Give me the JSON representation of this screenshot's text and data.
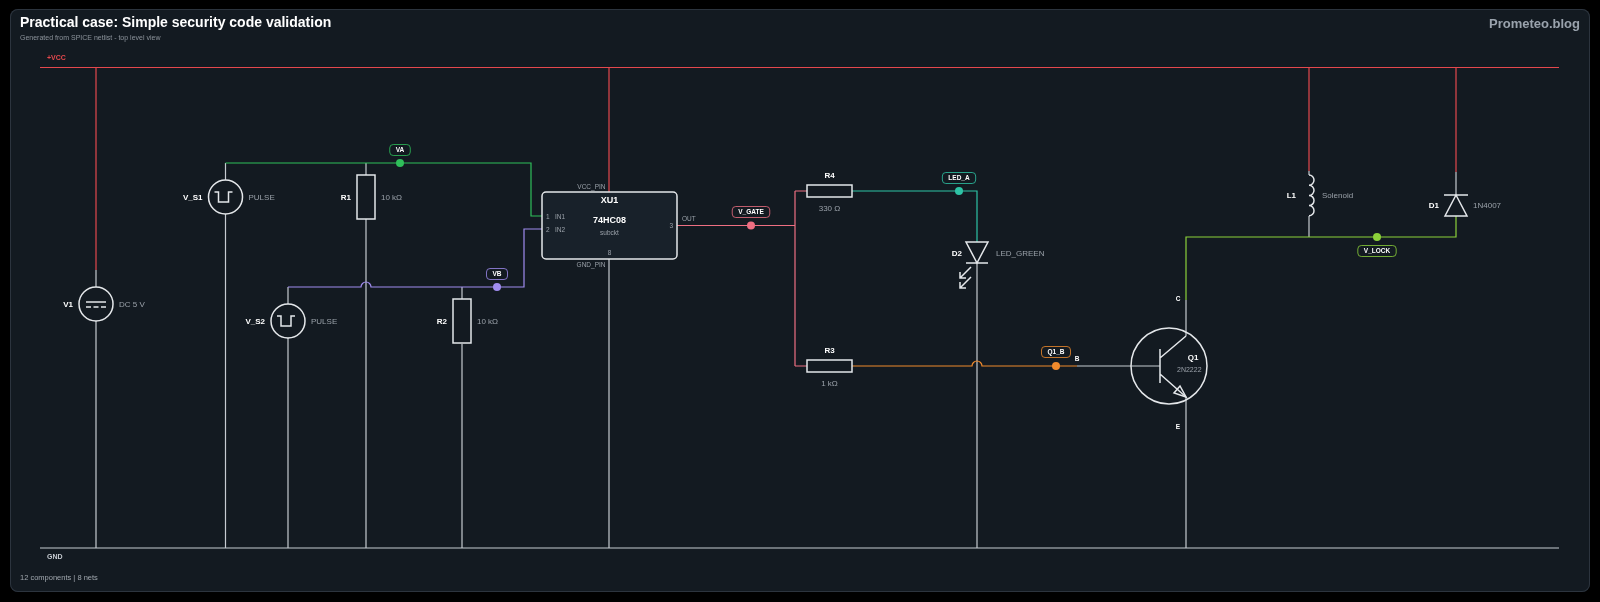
{
  "header": {
    "title": "Practical case: Simple security code validation",
    "subtitle": "Generated from SPICE netlist - top level view",
    "brand": "Prometeo.blog"
  },
  "schematic": {
    "rails": [
      {
        "kind": "vcc",
        "label": "+VCC"
      },
      {
        "kind": "gnd",
        "label": "GND"
      }
    ],
    "components": [
      {
        "kind": "dc_source",
        "ref": "V1",
        "value": "DC 5 V"
      },
      {
        "kind": "pulse_source",
        "ref": "V_S1",
        "value": "PULSE"
      },
      {
        "kind": "resistor",
        "ref": "R1",
        "value": "10 kΩ"
      },
      {
        "kind": "pulse_source",
        "ref": "V_S2",
        "value": "PULSE"
      },
      {
        "kind": "resistor",
        "ref": "R2",
        "value": "10 kΩ"
      },
      {
        "kind": "ic",
        "ref": "XU1",
        "value": "74HC08",
        "type": "subckt",
        "pins": [
          {
            "label": "IN1",
            "number": "1"
          },
          {
            "label": "IN2",
            "number": "2"
          },
          {
            "label": "OUT",
            "number": "3"
          },
          {
            "label": "VCC_PIN"
          },
          {
            "label": "GND_PIN",
            "number": "8"
          }
        ]
      },
      {
        "kind": "resistor",
        "ref": "R4",
        "value": "330 Ω"
      },
      {
        "kind": "resistor",
        "ref": "R3",
        "value": "1 kΩ"
      },
      {
        "kind": "led",
        "ref": "D2",
        "value": "LED_GREEN"
      },
      {
        "kind": "npn",
        "ref": "Q1",
        "value": "2N2222",
        "pins": [
          {
            "label": "B"
          },
          {
            "label": "C"
          },
          {
            "label": "E"
          }
        ]
      },
      {
        "kind": "inductor",
        "ref": "L1",
        "value": "Solenoid"
      },
      {
        "kind": "diode",
        "ref": "D1",
        "value": "1N4007"
      }
    ],
    "nets": [
      {
        "name": "VA",
        "color": "#2fbf5a"
      },
      {
        "name": "VB",
        "color": "#a08cf0"
      },
      {
        "name": "V_GATE",
        "color": "#ee6f82"
      },
      {
        "name": "LED_A",
        "color": "#2ec4a6"
      },
      {
        "name": "Q1_B",
        "color": "#f08a2c"
      },
      {
        "name": "V_LOCK",
        "color": "#8cd13a"
      }
    ]
  },
  "footer": "12 components | 8 nets"
}
